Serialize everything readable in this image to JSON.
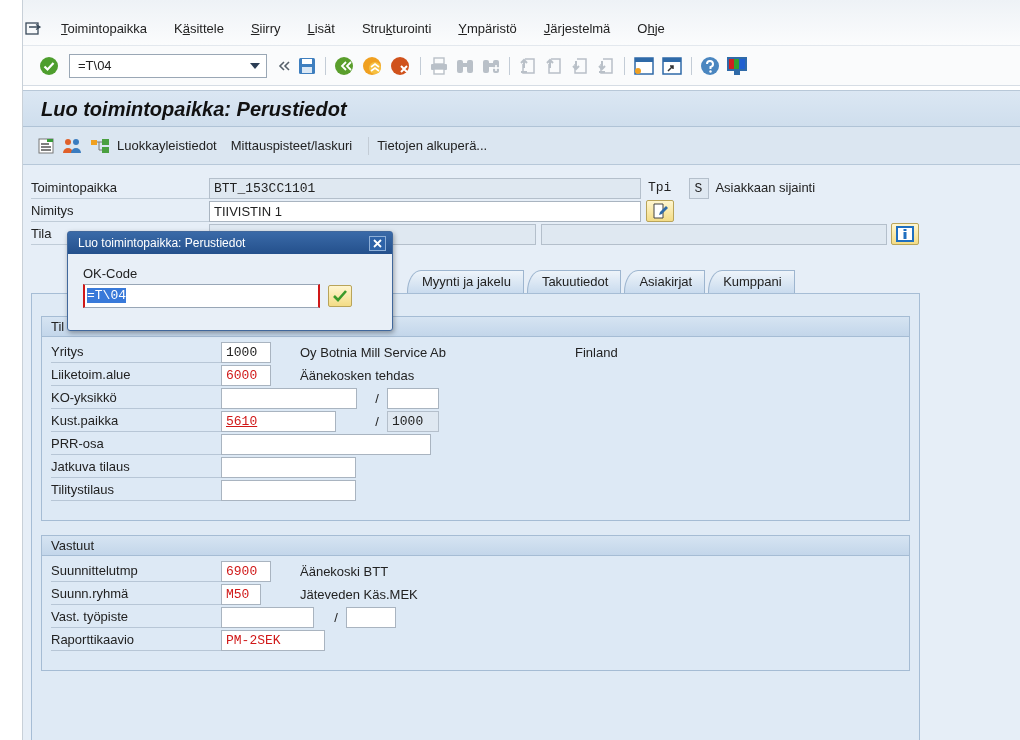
{
  "menu_bar": {
    "items": [
      {
        "key": "T",
        "after": "oimintopaikka"
      },
      {
        "before": "K",
        "key": "ä",
        "after": "sittele"
      },
      {
        "key": "S",
        "after": "iirry"
      },
      {
        "key": "L",
        "after": "isät"
      },
      {
        "before": "Stru",
        "key": "k",
        "after": "turointi"
      },
      {
        "key": "Y",
        "after": "mpäristö"
      },
      {
        "key": "J",
        "after": "ärjestelmä"
      },
      {
        "before": "O",
        "key": "h",
        "after": "je"
      }
    ]
  },
  "toolbar": {
    "items": [
      {
        "kind": "enter",
        "disabled": false
      },
      {
        "kind": "command",
        "value": "=T\\04"
      },
      {
        "kind": "history",
        "disabled": false
      },
      {
        "kind": "save",
        "disabled": false
      },
      {
        "kind": "separator"
      },
      {
        "kind": "back",
        "disabled": false
      },
      {
        "kind": "exit",
        "disabled": false
      },
      {
        "kind": "cancel",
        "disabled": false
      },
      {
        "kind": "separator"
      },
      {
        "kind": "print",
        "disabled": true
      },
      {
        "kind": "find",
        "disabled": true
      },
      {
        "kind": "find_next",
        "disabled": true
      },
      {
        "kind": "separator"
      },
      {
        "kind": "first_page",
        "disabled": true
      },
      {
        "kind": "previous_page",
        "disabled": true
      },
      {
        "kind": "next_page",
        "disabled": true
      },
      {
        "kind": "last_page",
        "disabled": true
      },
      {
        "kind": "separator"
      },
      {
        "kind": "new_session",
        "disabled": false
      },
      {
        "kind": "shortcut",
        "disabled": false
      },
      {
        "kind": "separator"
      },
      {
        "kind": "help",
        "disabled": false
      },
      {
        "kind": "layout",
        "disabled": false
      }
    ]
  },
  "title": "Luo toimintopaikka: Perustiedot",
  "app_toolbar": {
    "items": [
      {
        "kind": "document"
      },
      {
        "kind": "people"
      },
      {
        "kind": "structure"
      },
      {
        "kind": "text",
        "label": "Luokkayleistiedot"
      },
      {
        "kind": "text",
        "label": "Mittauspisteet/laskuri"
      },
      {
        "kind": "separator"
      },
      {
        "kind": "text",
        "label": "Tietojen alkuperä..."
      }
    ]
  },
  "header": {
    "location": {
      "label": "Toimintopaikka",
      "value": "BTT_153CC1101",
      "type_label": "Tpi",
      "type_value": "S",
      "type_text": "Asiakkaan sijainti"
    },
    "description": {
      "label": "Nimitys",
      "value": "TIIVISTIN 1"
    },
    "status": {
      "label": "Tila"
    }
  },
  "tabs": [
    {
      "label": "Myynti ja jakelu",
      "selected": false
    },
    {
      "label": "Takuutiedot",
      "selected": false
    },
    {
      "label": "Asiakirjat",
      "selected": false
    },
    {
      "label": "Kumppani",
      "selected": false
    }
  ],
  "sections": [
    {
      "title": "Til",
      "rows": [
        {
          "label": "Yritys",
          "fields": [
            {
              "value": "1000",
              "readonly": false,
              "modified": false
            }
          ],
          "text": "Oy Botnia Mill Service Ab",
          "text_2": "Finland"
        },
        {
          "label": "Liiketoim.alue",
          "fields": [
            {
              "value": "6000",
              "readonly": false,
              "modified": true
            }
          ],
          "text": "Äänekosken tehdas"
        },
        {
          "label": "KO-yksikkö",
          "fields": [
            {
              "readonly": false
            },
            {
              "readonly": false
            }
          ],
          "separator": "/"
        },
        {
          "label": "Kust.paikka",
          "fields": [
            {
              "value": "5610",
              "readonly": false,
              "modified": true,
              "underlined": true
            },
            {
              "value": "1000",
              "readonly": true
            }
          ],
          "separator": "/"
        },
        {
          "label": "PRR-osa",
          "fields": [
            {
              "readonly": false
            }
          ]
        },
        {
          "label": "Jatkuva tilaus",
          "fields": [
            {
              "readonly": false
            }
          ]
        },
        {
          "label": "Tilitystilaus",
          "fields": [
            {
              "readonly": false
            }
          ]
        }
      ]
    },
    {
      "title": "Vastuut",
      "rows": [
        {
          "label": "Suunnittelutmp",
          "fields": [
            {
              "value": "6900",
              "readonly": false,
              "modified": true
            }
          ],
          "text": "Äänekoski BTT"
        },
        {
          "label": "Suunn.ryhmä",
          "fields": [
            {
              "value": "M50",
              "readonly": false,
              "modified": true
            }
          ],
          "text": "Jäteveden Käs.MEK"
        },
        {
          "label": "Vast. työpiste",
          "fields": [
            {
              "readonly": false
            },
            {
              "readonly": false
            }
          ],
          "separator": "/"
        },
        {
          "label": "Raporttikaavio",
          "fields": [
            {
              "value": "PM-2SEK",
              "readonly": false,
              "modified": true
            }
          ]
        }
      ]
    }
  ],
  "dialog": {
    "title": "Luo toimintopaikka: Perustiedot",
    "field_label": "OK-Code",
    "value": "=T\\04",
    "value_selected": true
  }
}
